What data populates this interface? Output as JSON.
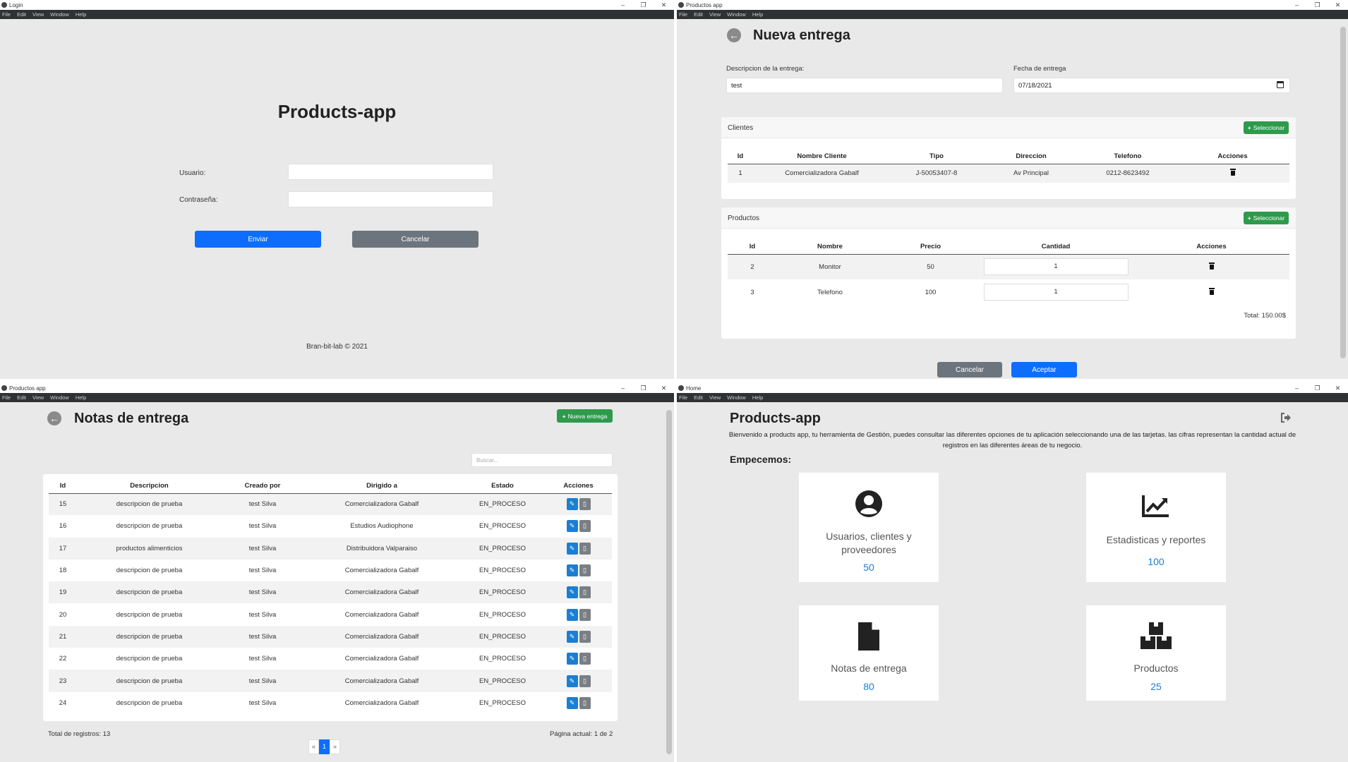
{
  "login": {
    "window_title": "Login",
    "menu": [
      "File",
      "Edit",
      "View",
      "Window",
      "Help"
    ],
    "title": "Products-app",
    "usuario_label": "Usuario:",
    "usuario_value": "",
    "password_label": "Contraseña:",
    "password_value": "",
    "submit_label": "Enviar",
    "cancel_label": "Cancelar",
    "footer": "Bran-bit-lab © 2021"
  },
  "nueva": {
    "window_title": "Productos app",
    "menu": [
      "File",
      "Edit",
      "View",
      "Window",
      "Help"
    ],
    "title": "Nueva entrega",
    "desc_label": "Descripcion de la entrega:",
    "desc_value": "test",
    "fecha_label": "Fecha de entrega",
    "fecha_value": "07/18/2021",
    "clientes": {
      "title": "Clientes",
      "select_label": "Seleccionar",
      "headers": [
        "Id",
        "Nombre Cliente",
        "Tipo",
        "Direccion",
        "Telefono",
        "Acciones"
      ],
      "rows": [
        [
          "1",
          "Comercializadora Gabalf",
          "J-50053407-8",
          "Av Principal",
          "0212-8623492"
        ]
      ]
    },
    "productos": {
      "title": "Productos",
      "select_label": "Seleccionar",
      "headers": [
        "Id",
        "Nombre",
        "Precio",
        "Cantidad",
        "Acciones"
      ],
      "rows": [
        [
          "2",
          "Monitor",
          "50",
          "1"
        ],
        [
          "3",
          "Telefono",
          "100",
          "1"
        ]
      ],
      "total": "Total: 150.00$"
    },
    "cancel_label": "Cancelar",
    "accept_label": "Aceptar"
  },
  "notas": {
    "window_title": "Productos app",
    "menu": [
      "File",
      "Edit",
      "View",
      "Window",
      "Help"
    ],
    "title": "Notas de entrega",
    "new_label": "Nueva entrega",
    "search_placeholder": "Buscar...",
    "headers": [
      "Id",
      "Descripcion",
      "Creado por",
      "Dirigido a",
      "Estado",
      "Acciones"
    ],
    "rows": [
      [
        "15",
        "descripcion de prueba",
        "test Silva",
        "Comercializadora Gabalf",
        "EN_PROCESO"
      ],
      [
        "16",
        "descripcion de prueba",
        "test Silva",
        "Estudios Audiophone",
        "EN_PROCESO"
      ],
      [
        "17",
        "productos alimenticios",
        "test Silva",
        "Distribuidora Valparaiso",
        "EN_PROCESO"
      ],
      [
        "18",
        "descripcion de prueba",
        "test Silva",
        "Comercializadora Gabalf",
        "EN_PROCESO"
      ],
      [
        "19",
        "descripcion de prueba",
        "test Silva",
        "Comercializadora Gabalf",
        "EN_PROCESO"
      ],
      [
        "20",
        "descripcion de prueba",
        "test Silva",
        "Comercializadora Gabalf",
        "EN_PROCESO"
      ],
      [
        "21",
        "descripcion de prueba",
        "test Silva",
        "Comercializadora Gabalf",
        "EN_PROCESO"
      ],
      [
        "22",
        "descripcion de prueba",
        "test Silva",
        "Comercializadora Gabalf",
        "EN_PROCESO"
      ],
      [
        "23",
        "descripcion de prueba",
        "test Silva",
        "Comercializadora Gabalf",
        "EN_PROCESO"
      ],
      [
        "24",
        "descripcion de prueba",
        "test Silva",
        "Comercializadora Gabalf",
        "EN_PROCESO"
      ]
    ],
    "total_text": "Total de registros: 13",
    "page_text": "Página actual: 1 de 2",
    "pages": [
      "«",
      "1",
      "»"
    ]
  },
  "home": {
    "window_title": "Home",
    "menu": [
      "File",
      "Edit",
      "View",
      "Window",
      "Help"
    ],
    "title": "Products-app",
    "intro": "Bienvenido a products app, tu herramienta de Gestión, puedes consultar las diferentes opciones de tu aplicación seleccionando una de las tarjetas. las cifras representan la cantidad actual de registros en las diferentes áreas de tu negocio.",
    "subtitle": "Empecemos:",
    "cards": [
      {
        "label": "Usuarios, clientes y proveedores",
        "count": "50",
        "icon": "user-circle-icon"
      },
      {
        "label": "Estadisticas y reportes",
        "count": "100",
        "icon": "chart-line-icon"
      },
      {
        "label": "Notas de entrega",
        "count": "80",
        "icon": "file-icon"
      },
      {
        "label": "Productos",
        "count": "25",
        "icon": "boxes-icon"
      }
    ]
  },
  "colors": {
    "primary": "#0d6efd",
    "secondary": "#6c757d",
    "success": "#2e9a4c",
    "accent_blue": "#1a7fd4"
  }
}
